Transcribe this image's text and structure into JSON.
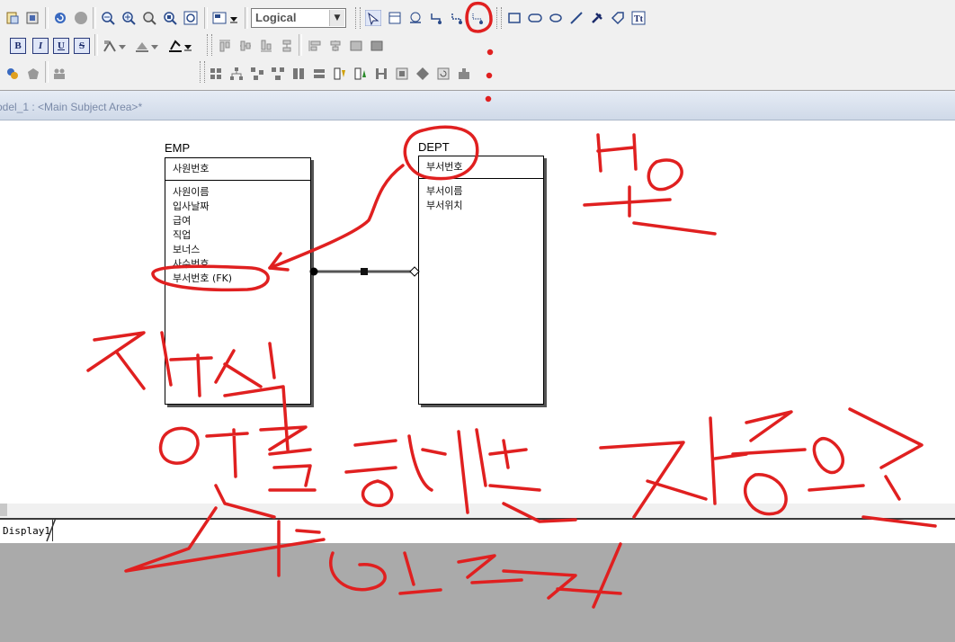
{
  "toolbar": {
    "diagram_level": "Logical",
    "row1_icons": [
      "open-report-icon",
      "properties-icon",
      "undo-icon",
      "stop-icon",
      "zoom-out-icon",
      "zoom-in-icon",
      "zoom-normal-icon",
      "zoom-page-icon",
      "fit-window-icon",
      "display-level-icon",
      "dropdown-arrow-icon"
    ],
    "row1_tools": [
      "pointer-tool-icon",
      "entity-tool-icon",
      "subtype-tool-icon",
      "identifying-relationship-icon",
      "non-identifying-relationship-icon",
      "relationship-tool-icon",
      "rectangle-icon",
      "rounded-rectangle-icon",
      "ellipse-icon",
      "line-icon",
      "pin-icon",
      "tag-icon",
      "text-tool-icon"
    ],
    "format_buttons": [
      "B",
      "I",
      "U",
      "S"
    ]
  },
  "window": {
    "title": "odel_1 : <Main Subject Area>*"
  },
  "diagram": {
    "entities": [
      {
        "name": "EMP",
        "key_attributes": [
          "사원번호"
        ],
        "attributes": [
          "사원이름",
          "입사날짜",
          "급여",
          "직업",
          "보너스",
          "사수번호",
          "부서번호 (FK)"
        ]
      },
      {
        "name": "DEPT",
        "key_attributes": [
          "부서번호"
        ],
        "attributes": [
          "부서이름",
          "부서위치"
        ]
      }
    ]
  },
  "tabs": [
    {
      "label": "Display1"
    }
  ],
  "annotations": {
    "color": "#e02020"
  }
}
